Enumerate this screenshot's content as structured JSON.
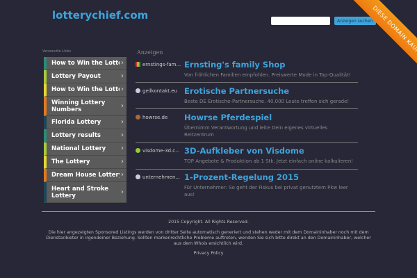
{
  "header": {
    "logo": "lotterychief.com",
    "search_placeholder": "",
    "search_button": "Anzeigen suchen",
    "ribbon": "DIESE DOMAIN KAUFEN."
  },
  "sidebar": {
    "label": "Verwandte Links",
    "items": [
      {
        "label": "How to Win the Lottery",
        "color": "#2e8a78"
      },
      {
        "label": "Lottery Payout",
        "color": "#a9c93a"
      },
      {
        "label": "How to Win the Lottery",
        "color": "#e6d635"
      },
      {
        "label": "Winning Lottery Numbers",
        "color": "#e37a1e"
      },
      {
        "label": "Florida Lottery",
        "color": "#1c4658"
      },
      {
        "label": "Lottery results",
        "color": "#2e8a78"
      },
      {
        "label": "National Lottery",
        "color": "#a9c93a"
      },
      {
        "label": "The Lottery",
        "color": "#e6d635"
      },
      {
        "label": "Dream House Lottery",
        "color": "#e37a1e"
      },
      {
        "label": "Heart and Stroke Lottery",
        "color": "#1c4658"
      }
    ]
  },
  "ads": {
    "label": "Anzeigen",
    "items": [
      {
        "domain": "ernstings-fam...",
        "title": "Ernsting's family Shop",
        "desc": "Von fröhlichen Familien empfohlen. Preiswerte Mode in Top-Qualität!",
        "icon": "ernstings-favicon"
      },
      {
        "domain": "geilkontakt.eu",
        "title": "Erotische Partnersuche",
        "desc": "Beste DE Erotische-Partnersuche. 40.000 Leute treffen sich gerade!",
        "icon": "globe-icon"
      },
      {
        "domain": "howrse.de",
        "title": "Howrse Pferdespiel",
        "desc": "Übernimm Verantwortung und leite Dein eigenes virtuelles Reitzentrum",
        "icon": "horse-icon"
      },
      {
        "domain": "visdome-3d.c...",
        "title": "3D-Aufkleber von Visdome",
        "desc": "TOP Angebote & Produktion ab 1 Stk. Jetzt einfach online kalkulieren!",
        "icon": "green-dot-icon"
      },
      {
        "domain": "unternehmen...",
        "title": "1-Prozent-Regelung 2015",
        "desc": "Für Unternehmer: So geht der Fiskus bei privat genutztem Pkw leer aus!",
        "icon": "globe-icon"
      }
    ]
  },
  "footer": {
    "copyright": "2015 Copyright. All Rights Reserved.",
    "disclaimer": "Die hier angezeigten Sponsored Listings werden von dritter Seite automatisch generiert und stehen weder mit dem Domaininhaber noch mit dem Dienstanbieter in irgendeiner Beziehung. Sollten markenrechtliche Probleme auftreten, wenden Sie sich bitte direkt an den Domaininhaber, welcher aus dem Whois ersichtlich wird.",
    "privacy": "Privacy Policy"
  }
}
